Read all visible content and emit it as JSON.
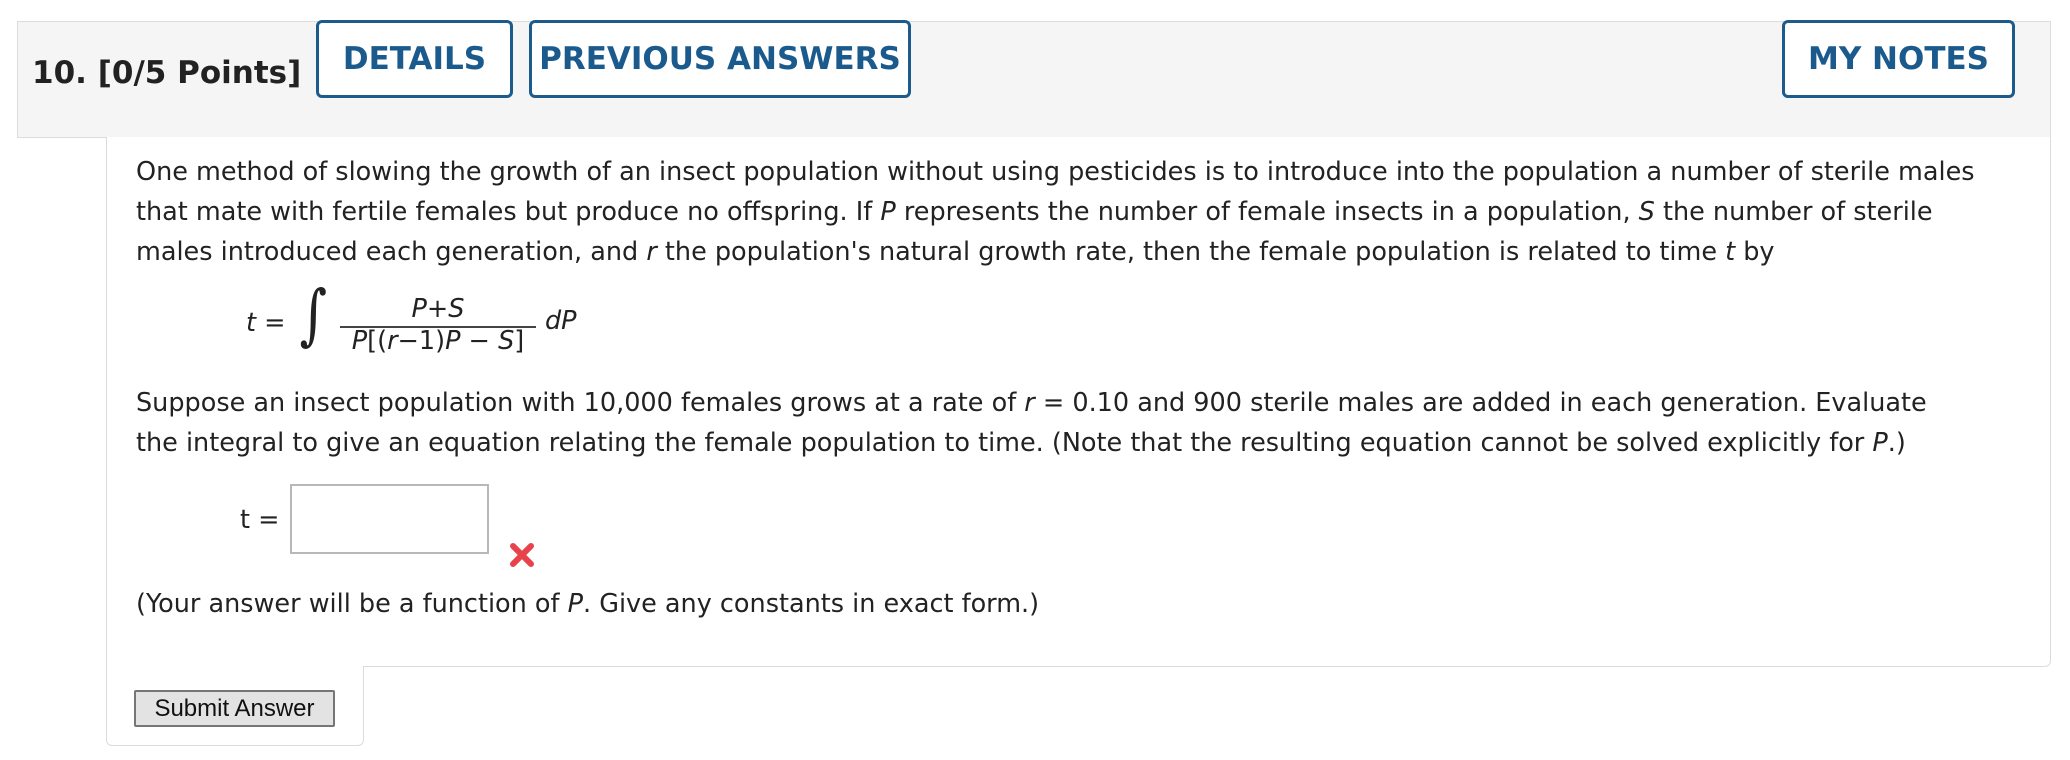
{
  "question": {
    "number_points": "10.  [0/5 Points]",
    "buttons": {
      "details": "DETAILS",
      "previous_answers": "PREVIOUS ANSWERS",
      "my_notes": "MY NOTES"
    }
  },
  "intro": {
    "l1": "One method of slowing the growth of an insect population without using pesticides is to introduce into the population a number of sterile males",
    "l2a": "that mate with fertile females but produce no offspring. If ",
    "l2b": "P",
    "l2c": " represents the number of female insects in a population, ",
    "l2d": "S",
    "l2e": " the number of sterile",
    "l3a": "males introduced each generation, and ",
    "l3b": "r",
    "l3c": " the population's natural growth rate, then the female population is related to time ",
    "l3d": "t",
    "l3e": " by"
  },
  "formula": {
    "lhs": "t =",
    "integral": "∫",
    "numerator": "P+S",
    "den_a": "P",
    "den_b": "[(",
    "den_c": "r",
    "den_d": "−1)",
    "den_e": "P",
    "den_f": " − ",
    "den_g": "S",
    "den_h": "]",
    "differential": "dP"
  },
  "problem": {
    "l1a": "Suppose an insect population with 10,000 females grows at a rate of ",
    "l1b": "r",
    "l1c": " = 0.10 and 900 sterile males are added in each generation. Evaluate",
    "l2a": "the integral to give an equation relating the female population to time. (Note that the resulting equation cannot be solved explicitly for ",
    "l2b": "P",
    "l2c": ".)"
  },
  "answer": {
    "label": "t =",
    "value": "",
    "status": "incorrect",
    "status_color": "#e8434a"
  },
  "hint": {
    "a": "(Your answer will be a function of ",
    "b": "P",
    "c": ". Give any constants in exact form.)"
  },
  "submit": {
    "label": "Submit Answer"
  },
  "colors": {
    "accent": "#1c5b8c",
    "header_bg": "#f5f5f5"
  }
}
